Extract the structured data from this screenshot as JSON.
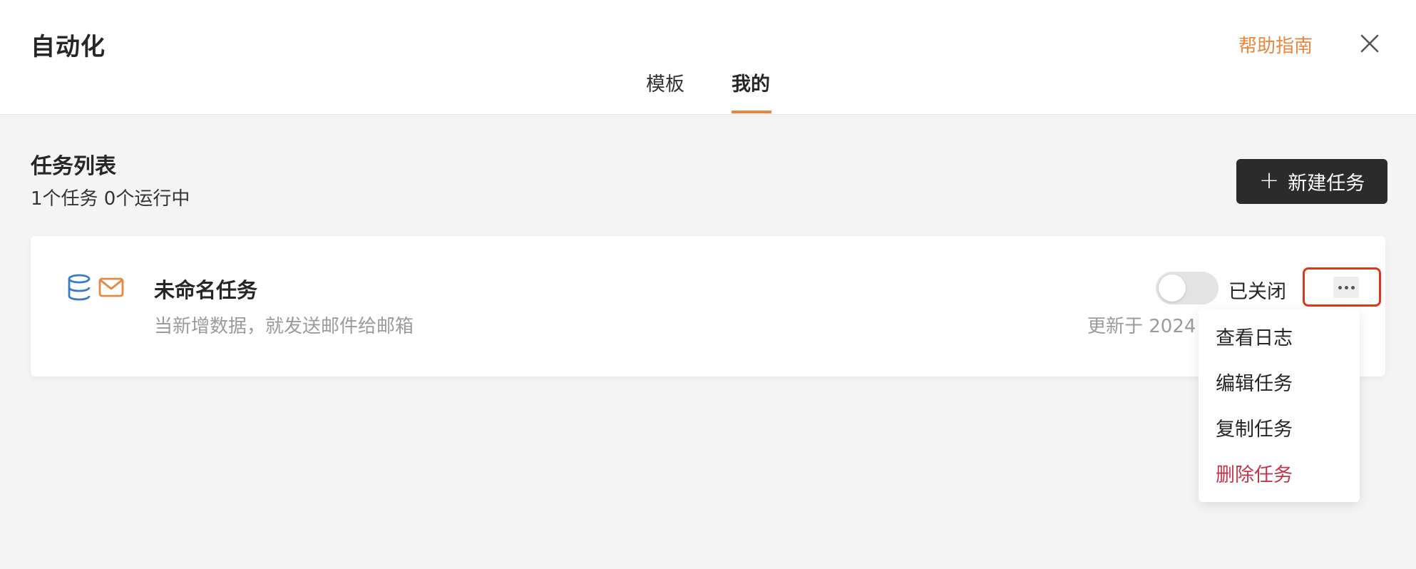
{
  "header": {
    "title": "自动化",
    "help_label": "帮助指南",
    "close_icon": "close-icon"
  },
  "tabs": [
    {
      "label": "模板",
      "active": false
    },
    {
      "label": "我的",
      "active": true
    }
  ],
  "colors": {
    "accent": "#e8873f",
    "danger": "#c3354c",
    "highlight_border": "#e0341d",
    "primary_button": "#2b2b2b"
  },
  "task_list": {
    "title": "任务列表",
    "summary": "1个任务 0个运行中",
    "new_task_label": "新建任务",
    "new_task_icon": "plus-icon"
  },
  "task": {
    "name": "未命名任务",
    "description": "当新增数据，就发送邮件给邮箱",
    "icons": [
      "database-icon",
      "mail-icon"
    ],
    "toggle_on": false,
    "status_label": "已关闭",
    "updated": "更新于 2024",
    "more_icon": "more-icon"
  },
  "menu": {
    "items": [
      {
        "label": "查看日志",
        "danger": false
      },
      {
        "label": "编辑任务",
        "danger": false
      },
      {
        "label": "复制任务",
        "danger": false
      },
      {
        "label": "删除任务",
        "danger": true
      }
    ]
  }
}
